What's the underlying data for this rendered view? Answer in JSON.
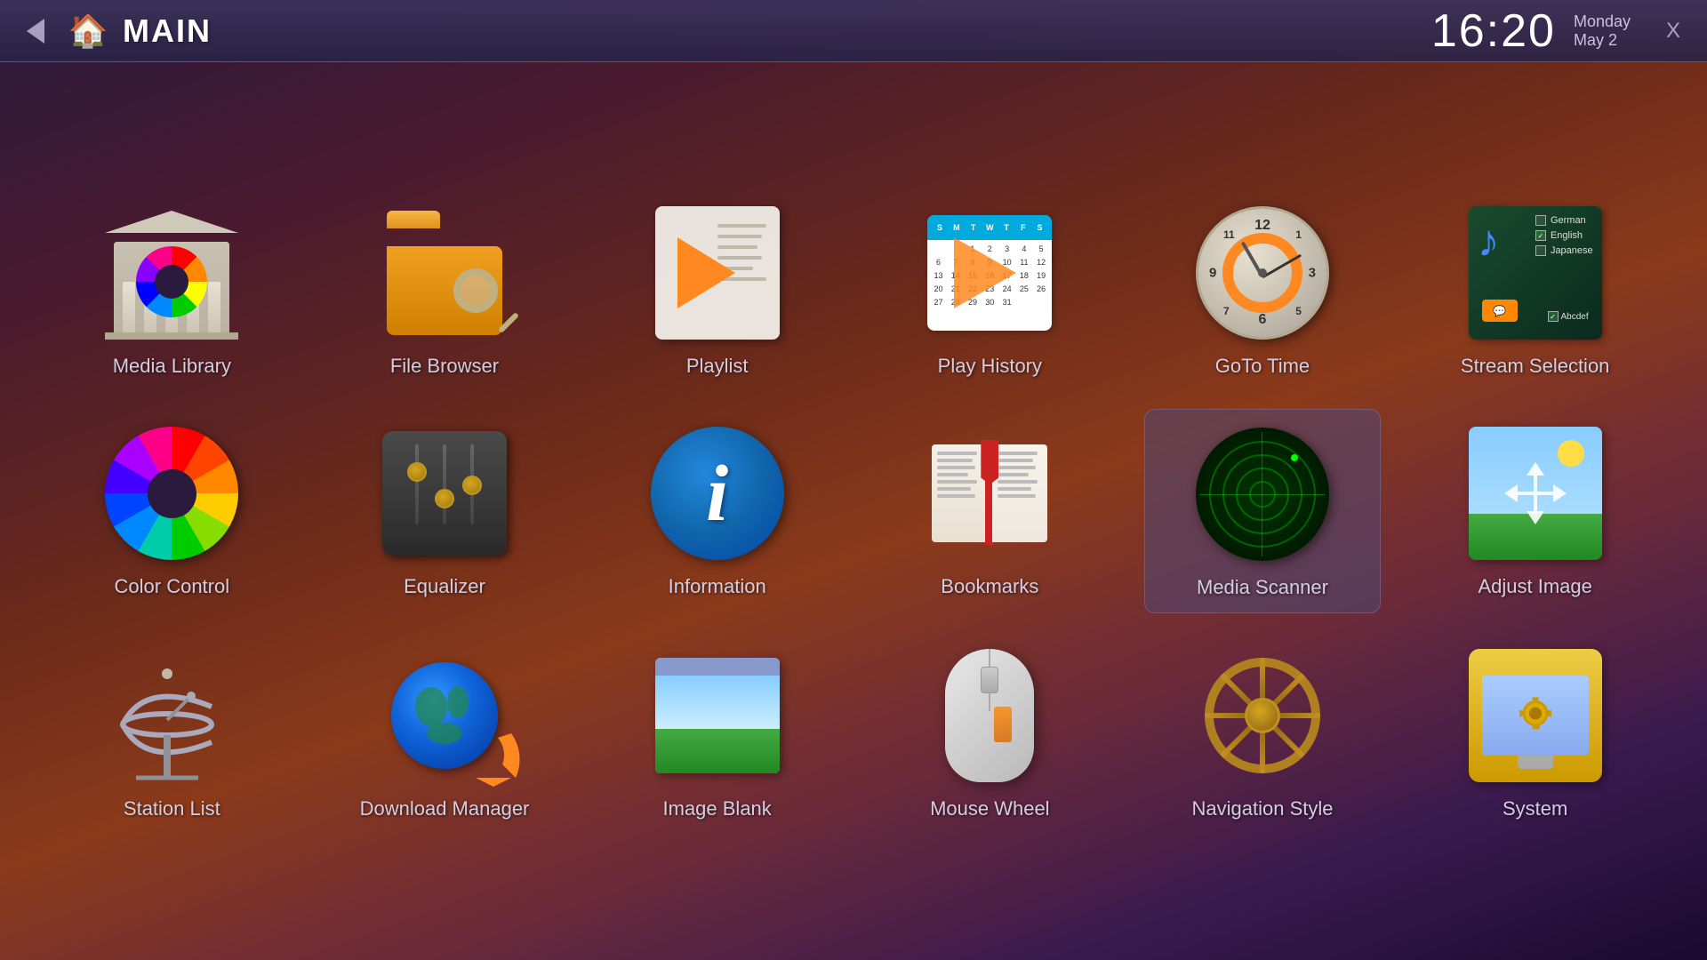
{
  "header": {
    "title": "MAIN",
    "back_label": "back",
    "clock": "16:20",
    "day": "Monday",
    "date": "May 2",
    "close_label": "X"
  },
  "apps": {
    "row1": [
      {
        "id": "media-library",
        "label": "Media Library"
      },
      {
        "id": "file-browser",
        "label": "File Browser"
      },
      {
        "id": "playlist",
        "label": "Playlist"
      },
      {
        "id": "play-history",
        "label": "Play History"
      },
      {
        "id": "goto-time",
        "label": "GoTo Time"
      },
      {
        "id": "stream-selection",
        "label": "Stream Selection"
      }
    ],
    "row2": [
      {
        "id": "color-control",
        "label": "Color Control"
      },
      {
        "id": "equalizer",
        "label": "Equalizer"
      },
      {
        "id": "information",
        "label": "Information"
      },
      {
        "id": "bookmarks",
        "label": "Bookmarks"
      },
      {
        "id": "media-scanner",
        "label": "Media Scanner"
      },
      {
        "id": "adjust-image",
        "label": "Adjust Image"
      }
    ],
    "row3": [
      {
        "id": "station-list",
        "label": "Station List"
      },
      {
        "id": "download-manager",
        "label": "Download Manager"
      },
      {
        "id": "image-blank",
        "label": "Image Blank"
      },
      {
        "id": "mouse-wheel",
        "label": "Mouse Wheel"
      },
      {
        "id": "navigation-style",
        "label": "Navigation Style"
      },
      {
        "id": "system",
        "label": "System"
      }
    ]
  },
  "calendar": {
    "days": [
      "S",
      "M",
      "T",
      "W",
      "T",
      "F",
      "S"
    ],
    "dates": [
      "",
      "",
      "1",
      "2",
      "3",
      "4",
      "5",
      "6",
      "7",
      "8",
      "9",
      "10",
      "11",
      "12",
      "13",
      "14",
      "15",
      "16",
      "17",
      "18",
      "19",
      "20",
      "21",
      "22",
      "23",
      "24",
      "25",
      "26",
      "27",
      "28",
      "29",
      "30",
      "31"
    ]
  },
  "stream": {
    "languages": [
      {
        "label": "German",
        "checked": false
      },
      {
        "label": "English",
        "checked": true
      },
      {
        "label": "Japanese",
        "checked": false
      }
    ]
  }
}
